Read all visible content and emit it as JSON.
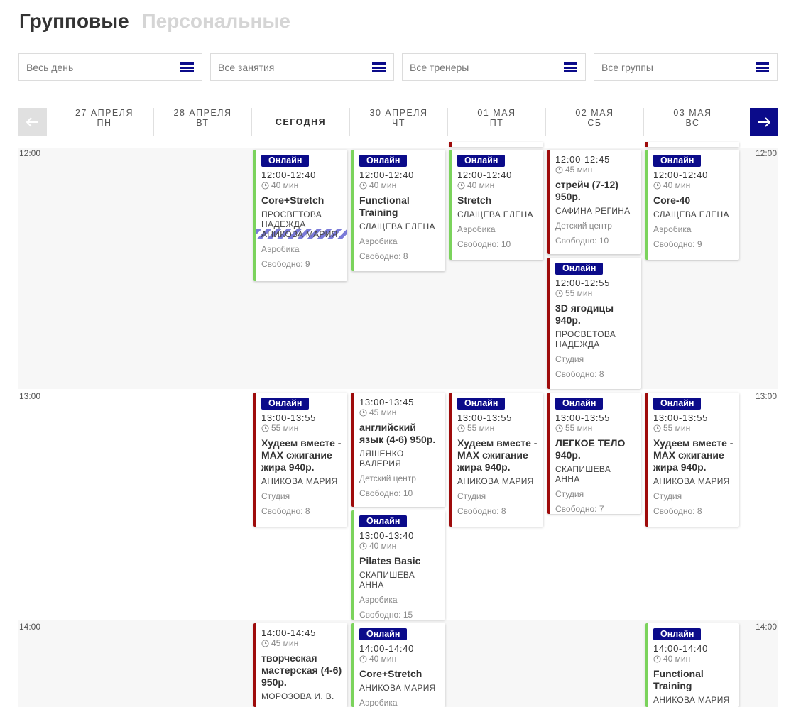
{
  "tabs": {
    "group": "Групповые",
    "personal": "Персональные"
  },
  "filters": {
    "time": "Весь день",
    "activity": "Все занятия",
    "trainer": "Все тренеры",
    "group": "Все группы"
  },
  "days": [
    {
      "date": "27 АПРЕЛЯ",
      "weekday": "ПН"
    },
    {
      "date": "28 АПРЕЛЯ",
      "weekday": "ВТ"
    },
    {
      "date": "СЕГОДНЯ",
      "weekday": ""
    },
    {
      "date": "30 АПРЕЛЯ",
      "weekday": "ЧТ"
    },
    {
      "date": "01 МАЯ",
      "weekday": "ПТ"
    },
    {
      "date": "02 МАЯ",
      "weekday": "СБ"
    },
    {
      "date": "03 МАЯ",
      "weekday": "ВС"
    }
  ],
  "hours": {
    "h12": "12:00",
    "h13": "13:00",
    "h14": "14:00"
  },
  "colors": {
    "accent": "#0b0b8a",
    "green": "#7bd35c",
    "red": "#9e0b0b"
  },
  "cards": [
    {
      "online": "Онлайн",
      "time": "12:00-12:40",
      "dur": "40 мин",
      "title": "Core+Stretch",
      "coach": "ПРОСВЕТОВА НАДЕЖДА",
      "coach2": "АНИКОВА МАРИЯ",
      "place": "Аэробика",
      "free": "Свободно: 9"
    },
    {
      "online": "Онлайн",
      "time": "12:00-12:40",
      "dur": "40 мин",
      "title": "Functional Training",
      "coach": "СЛАЩЕВА ЕЛЕНА",
      "place": "Аэробика",
      "free": "Свободно: 8"
    },
    {
      "online": "Онлайн",
      "time": "12:00-12:40",
      "dur": "40 мин",
      "title": "Stretch",
      "coach": "СЛАЩЕВА ЕЛЕНА",
      "place": "Аэробика",
      "free": "Свободно: 10"
    },
    {
      "time": "12:00-12:45",
      "dur": "45 мин",
      "title": "стрейч (7-12) 950р.",
      "coach": "САФИНА РЕГИНА",
      "place": "Детский центр",
      "free": "Свободно: 10"
    },
    {
      "online": "Онлайн",
      "time": "12:00-12:40",
      "dur": "40 мин",
      "title": "Core-40",
      "coach": "СЛАЩЕВА ЕЛЕНА",
      "place": "Аэробика",
      "free": "Свободно: 9"
    },
    {
      "online": "Онлайн",
      "time": "12:00-12:55",
      "dur": "55 мин",
      "title": "3D ягодицы 940р.",
      "coach": "ПРОСВЕТОВА НАДЕЖДА",
      "place": "Студия",
      "free": "Свободно: 8"
    },
    {
      "online": "Онлайн",
      "time": "13:00-13:55",
      "dur": "55 мин",
      "title": "Худеем вместе - MAX сжигание жира 940р.",
      "coach": "АНИКОВА МАРИЯ",
      "place": "Студия",
      "free": "Свободно: 8"
    },
    {
      "time": "13:00-13:45",
      "dur": "45 мин",
      "title": "английский язык (4-6) 950р.",
      "coach": "ЛЯШЕНКО ВАЛЕРИЯ",
      "place": "Детский центр",
      "free": "Свободно: 10"
    },
    {
      "online": "Онлайн",
      "time": "13:00-13:55",
      "dur": "55 мин",
      "title": "Худеем вместе - MAX сжигание жира 940р.",
      "coach": "АНИКОВА МАРИЯ",
      "place": "Студия",
      "free": "Свободно: 8"
    },
    {
      "online": "Онлайн",
      "time": "13:00-13:55",
      "dur": "55 мин",
      "title": "ЛЕГКОЕ ТЕЛО 940р.",
      "coach": "СКАПИШЕВА АННА",
      "place": "Студия",
      "free": "Свободно: 7"
    },
    {
      "online": "Онлайн",
      "time": "13:00-13:55",
      "dur": "55 мин",
      "title": "Худеем вместе - MAX сжигание жира 940р.",
      "coach": "АНИКОВА МАРИЯ",
      "place": "Студия",
      "free": "Свободно: 8"
    },
    {
      "online": "Онлайн",
      "time": "13:00-13:40",
      "dur": "40 мин",
      "title": "Pilates Basic",
      "coach": "СКАПИШЕВА АННА",
      "place": "Аэробика",
      "free": "Свободно: 15"
    },
    {
      "time": "14:00-14:45",
      "dur": "45 мин",
      "title": "творческая мастерская (4-6) 950р.",
      "coach": "МОРОЗОВА И. В."
    },
    {
      "online": "Онлайн",
      "time": "14:00-14:40",
      "dur": "40 мин",
      "title": "Core+Stretch",
      "coach": "АНИКОВА МАРИЯ",
      "place": "Аэробика"
    },
    {
      "online": "Онлайн",
      "time": "14:00-14:40",
      "dur": "40 мин",
      "title": "Functional Training",
      "coach": "АНИКОВА МАРИЯ"
    }
  ]
}
